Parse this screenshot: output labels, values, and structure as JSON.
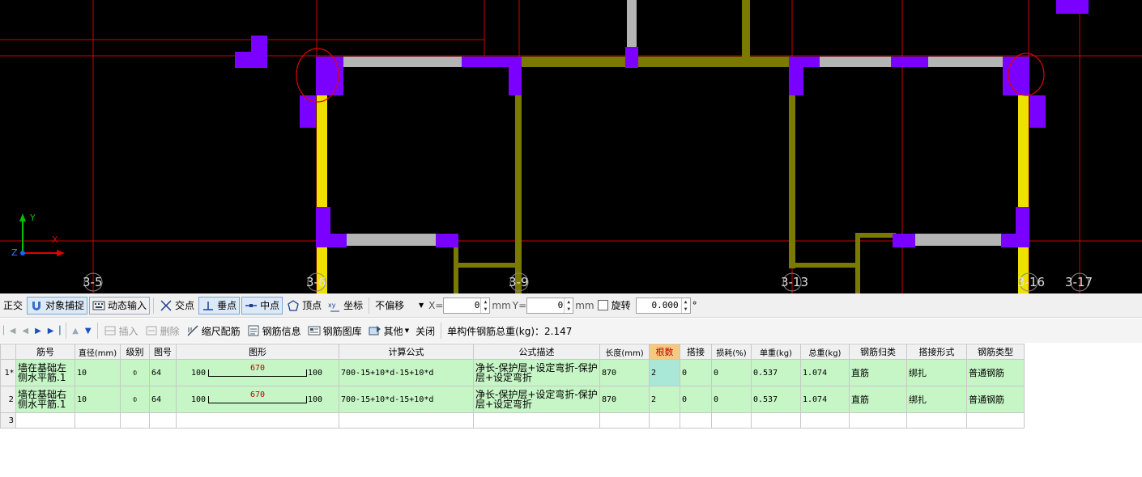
{
  "canvas": {
    "axis_labels": [
      "3-5",
      "3-6",
      "3-9",
      "3-13",
      "3-16",
      "3-17"
    ],
    "coord_x": "X",
    "coord_y": "Y",
    "coord_z": "Z"
  },
  "snap_toolbar": {
    "ortho": "正交",
    "object_snap": "对象捕捉",
    "dynamic_input": "动态输入",
    "intersection": "交点",
    "perpendicular": "垂点",
    "midpoint": "中点",
    "vertex": "顶点",
    "coordinate": "坐标",
    "offset_mode": "不偏移",
    "x_label": "X=",
    "x_value": "0",
    "x_unit": "mm",
    "y_label": "Y=",
    "y_value": "0",
    "y_unit": "mm",
    "rotate_label": "旋转",
    "rotate_value": "0.000",
    "degree": "°"
  },
  "grid_toolbar": {
    "insert": "插入",
    "delete": "删除",
    "scale_rebar": "缩尺配筋",
    "rebar_info": "钢筋信息",
    "rebar_library": "钢筋图库",
    "other": "其他",
    "close": "关闭",
    "total_weight_label": "单构件钢筋总重(kg)：2.147"
  },
  "table": {
    "headers": [
      "筋号",
      "直径(mm)",
      "级别",
      "图号",
      "图形",
      "计算公式",
      "公式描述",
      "长度(mm)",
      "根数",
      "搭接",
      "损耗(%)",
      "单重(kg)",
      "总重(kg)",
      "钢筋归类",
      "搭接形式",
      "钢筋类型"
    ],
    "rows": [
      {
        "rownum": "1*",
        "name": "墙在基础左侧水平筋.1",
        "diameter": "10",
        "grade": "⌽",
        "fig": "64",
        "shape_left": "100",
        "shape_mid": "670",
        "shape_right": "100",
        "formula": "700-15+10*d-15+10*d",
        "desc": "净长-保护层+设定弯折-保护层+设定弯折",
        "length": "870",
        "count": "2",
        "lap": "0",
        "loss": "0",
        "unit_w": "0.537",
        "total_w": "1.074",
        "category": "直筋",
        "lap_form": "绑扎",
        "rebar_type": "普通钢筋"
      },
      {
        "rownum": "2",
        "name": "墙在基础右侧水平筋.1",
        "diameter": "10",
        "grade": "⌽",
        "fig": "64",
        "shape_left": "100",
        "shape_mid": "670",
        "shape_right": "100",
        "formula": "700-15+10*d-15+10*d",
        "desc": "净长-保护层+设定弯折-保护层+设定弯折",
        "length": "870",
        "count": "2",
        "lap": "0",
        "loss": "0",
        "unit_w": "0.537",
        "total_w": "1.074",
        "category": "直筋",
        "lap_form": "绑扎",
        "rebar_type": "普通钢筋"
      }
    ],
    "empty_rownum": "3"
  },
  "colors": {
    "grid_line": "#d00000",
    "wall_gray": "#b4b4b4",
    "column_purple": "#7a00ff",
    "beam_olive": "#7a7a00",
    "wall_yellow": "#f0e000",
    "row_green": "#c6f5c6"
  }
}
